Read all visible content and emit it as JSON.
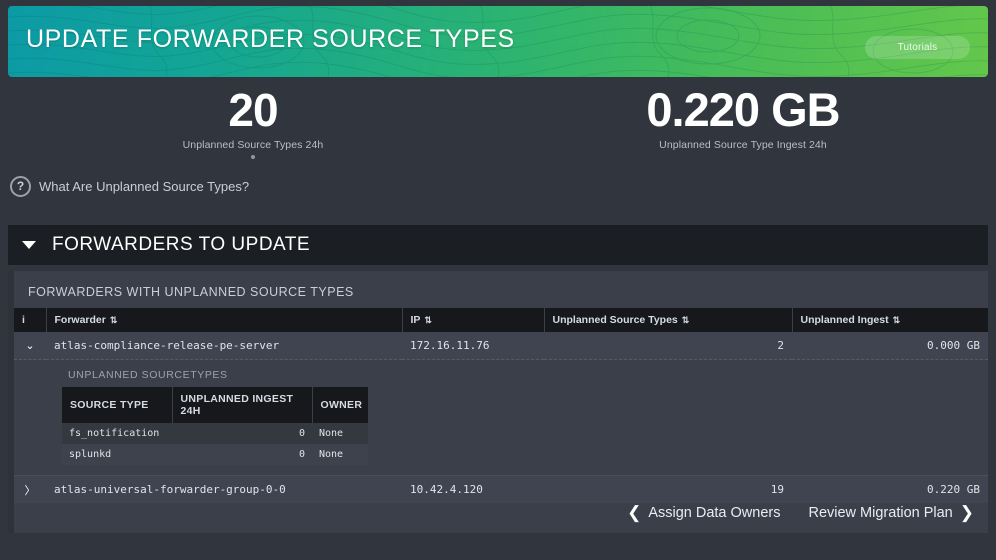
{
  "banner": {
    "title": "UPDATE FORWARDER SOURCE TYPES",
    "tutorials_label": "Tutorials"
  },
  "metrics": [
    {
      "value": "20",
      "label": "Unplanned Source Types 24h"
    },
    {
      "value": "0.220 GB",
      "label": "Unplanned Source Type Ingest 24h"
    }
  ],
  "help": {
    "icon": "question-mark-icon",
    "text": "What Are Unplanned Source Types?"
  },
  "section": {
    "title": "FORWARDERS TO UPDATE",
    "caret": "caret-down-icon"
  },
  "panel": {
    "title": "FORWARDERS WITH UNPLANNED SOURCE TYPES",
    "columns": {
      "info": "i",
      "forwarder": "Forwarder",
      "ip": "IP",
      "unplanned_source_types": "Unplanned Source Types",
      "unplanned_ingest": "Unplanned Ingest"
    },
    "sort_glyph": "⇅",
    "rows": [
      {
        "expanded": true,
        "expander_glyph": "⌄",
        "forwarder": "atlas-compliance-release-pe-server",
        "ip": "172.16.11.76",
        "unplanned_source_types": "2",
        "unplanned_ingest": "0.000 GB",
        "detail": {
          "title": "UNPLANNED SOURCETYPES",
          "columns": {
            "source_type": "SOURCE TYPE",
            "unplanned_ingest_24h": "UNPLANNED INGEST 24H",
            "owner": "OWNER"
          },
          "rows": [
            {
              "source_type": "fs_notification",
              "unplanned_ingest_24h": "0",
              "owner": "None"
            },
            {
              "source_type": "splunkd",
              "unplanned_ingest_24h": "0",
              "owner": "None"
            }
          ]
        }
      },
      {
        "expanded": false,
        "expander_glyph": "〉",
        "forwarder": "atlas-universal-forwarder-group-0-0",
        "ip": "10.42.4.120",
        "unplanned_source_types": "19",
        "unplanned_ingest": "0.220 GB",
        "detail": null
      }
    ]
  },
  "footer": {
    "prev_label": "Assign Data Owners",
    "prev_glyph": "❮",
    "next_label": "Review Migration Plan",
    "next_glyph": "❯"
  },
  "colors": {
    "page_background": "#31353d",
    "panel_background": "#3a3f49",
    "row_background": "#3f4450",
    "header_row": "#16181c",
    "section_header": "#1b1e23",
    "banner_from": "#0c9aa6",
    "banner_to": "#63c74b",
    "text_primary": "#ffffff",
    "text_muted": "#c8ced7"
  }
}
